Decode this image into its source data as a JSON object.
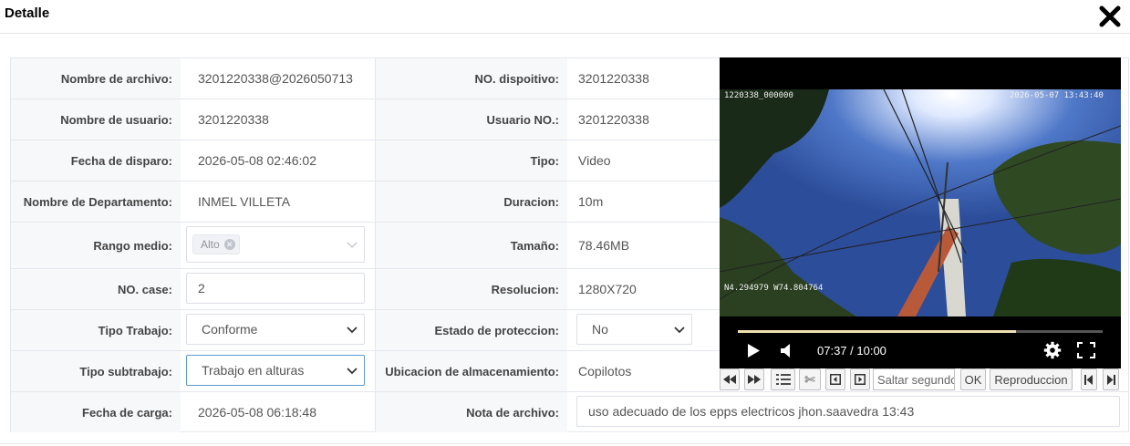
{
  "dialog": {
    "title": "Detalle",
    "close_icon": "close-x-icon"
  },
  "left_rows": [
    {
      "label": "Nombre de archivo:",
      "value": "3201220338@2026050713"
    },
    {
      "label": "Nombre de usuario:",
      "value": "3201220338"
    },
    {
      "label": "Fecha de disparo:",
      "value": "2026-05-08 02:46:02"
    },
    {
      "label": "Nombre de Departamento:",
      "value": "INMEL VILLETA"
    },
    {
      "label": "Rango medio:",
      "value": "Alto"
    },
    {
      "label": "NO. case:",
      "value": "2"
    },
    {
      "label": "Tipo Trabajo:",
      "value": "Conforme"
    },
    {
      "label": "Tipo subtrabajo:",
      "value": "Trabajo en alturas"
    },
    {
      "label": "Fecha de carga:",
      "value": "2026-05-08 06:18:48"
    }
  ],
  "right_rows": [
    {
      "label": "NO. dispoitivo:",
      "value": "3201220338"
    },
    {
      "label": "Usuario NO.:",
      "value": "3201220338"
    },
    {
      "label": "Tipo:",
      "value": "Video"
    },
    {
      "label": "Duracion:",
      "value": "10m"
    },
    {
      "label": "Tamaño:",
      "value": "78.46MB"
    },
    {
      "label": "Resolucion:",
      "value": "1280X720"
    },
    {
      "label": "Estado de proteccion:",
      "value": "No"
    },
    {
      "label": "Ubicacion de almacenamiento:",
      "value": "Copilotos"
    },
    {
      "label": "Nota de archivo:",
      "value": "uso adecuado de los epps electricos jhon.saavedra 13:43"
    }
  ],
  "player": {
    "osd_top_left": "1220338_000000",
    "osd_top_right": "2026-05-07  13:43:40",
    "osd_bottom_left": "N4.294979  W74.804764",
    "time": "07:37 / 10:00",
    "progress": 0.762
  },
  "toolbar": {
    "seek_placeholder": "Saltar segundos",
    "ok_label": "OK",
    "playback_label": "Reproduccion"
  }
}
